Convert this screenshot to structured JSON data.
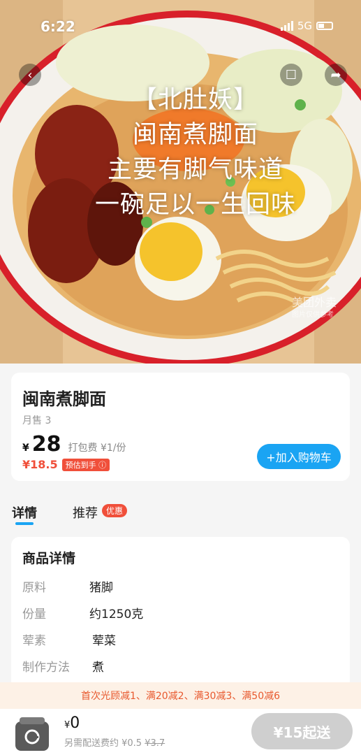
{
  "status": {
    "time": "6:22",
    "network": "5G"
  },
  "hero": {
    "overlay_lines": [
      "【北肚妖】",
      "闽南煮脚面",
      "主要有脚气味道",
      "一碗足以一生回味"
    ],
    "watermark_main": "美团外卖",
    "watermark_sub": "图片仅供参考"
  },
  "header_icons": {
    "back": "back-arrow-icon",
    "comment": "comment-icon",
    "share": "share-icon"
  },
  "product": {
    "name": "闽南煮脚面",
    "sales": "月售 3",
    "price_symbol": "¥",
    "price": "28",
    "packaging_fee": "打包费 ¥1/份",
    "estimated_price": "¥18.5",
    "estimated_tag": "预估到手 ⓘ",
    "add_to_cart": "+加入购物车"
  },
  "tabs": {
    "details": "详情",
    "recommend": "推荐",
    "recommend_badge": "优惠"
  },
  "details": {
    "title": "商品详情",
    "rows": [
      {
        "key": "原料",
        "value": "猪脚"
      },
      {
        "key": "份量",
        "value": "约1250克"
      },
      {
        "key": "荤素",
        "value": "荤菜"
      },
      {
        "key": "制作方法",
        "value": "煮"
      }
    ]
  },
  "promo": {
    "text": "首次光顾减1、满20减2、满30减3、满50减6"
  },
  "bottom": {
    "total_symbol": "¥",
    "total": "0",
    "delivery_fee_label": "另需配送费约 ¥0.5",
    "delivery_fee_original": "¥3.7",
    "min_order_button": "¥15起送"
  },
  "colors": {
    "accent": "#1aa4f3",
    "price_red": "#f04f3a",
    "promo_bg": "#fdf1e6",
    "disabled": "#cfcfcf"
  }
}
